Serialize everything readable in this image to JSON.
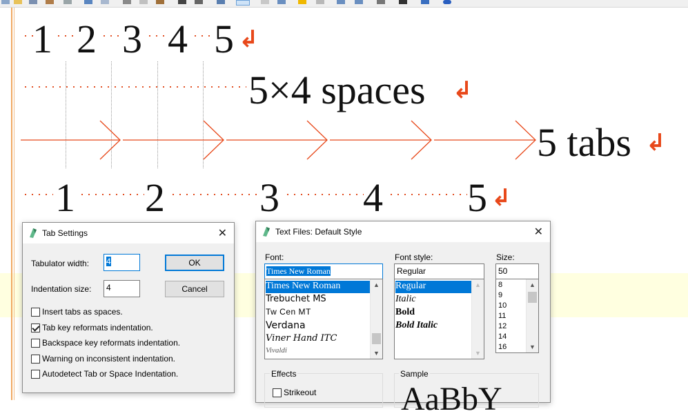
{
  "editor": {
    "line1": [
      "1",
      "2",
      "3",
      "4",
      "5"
    ],
    "line2_text": "5×4 spaces",
    "line3_text": "5 tabs",
    "line4": [
      "1",
      "2",
      "3",
      "4",
      "5"
    ],
    "eol_glyph": "↲"
  },
  "tab_settings": {
    "title": "Tab Settings",
    "close_glyph": "✕",
    "tab_width_label": "Tabulator width:",
    "tab_width_value": "4",
    "indent_size_label": "Indentation size:",
    "indent_size_value": "4",
    "ok_label": "OK",
    "cancel_label": "Cancel",
    "options": [
      {
        "label": "Insert tabs as spaces.",
        "checked": false
      },
      {
        "label": "Tab key reformats indentation.",
        "checked": true
      },
      {
        "label": "Backspace key reformats indentation.",
        "checked": false
      },
      {
        "label": "Warning on inconsistent indentation.",
        "checked": false
      },
      {
        "label": "Autodetect Tab or Space Indentation.",
        "checked": false
      }
    ]
  },
  "font_dialog": {
    "title": "Text Files: Default Style",
    "close_glyph": "✕",
    "font_label": "Font:",
    "font_value": "Times New Roman",
    "fonts": [
      "Times New Roman",
      "Trebuchet MS",
      "Tw Cen MT",
      "Verdana",
      "Viner Hand ITC",
      "Vivaldi"
    ],
    "style_label": "Font style:",
    "style_value": "Regular",
    "styles": [
      "Regular",
      "Italic",
      "Bold",
      "Bold Italic"
    ],
    "size_label": "Size:",
    "size_value": "50",
    "sizes": [
      "8",
      "9",
      "10",
      "11",
      "12",
      "14",
      "16"
    ],
    "effects_label": "Effects",
    "strikeout_label": "Strikeout",
    "sample_label": "Sample",
    "sample_text": "AaBbY"
  },
  "colors": {
    "whitespace_marker": "#e04010",
    "selection": "#0078d7",
    "highlight_line": "#ffffe0"
  }
}
